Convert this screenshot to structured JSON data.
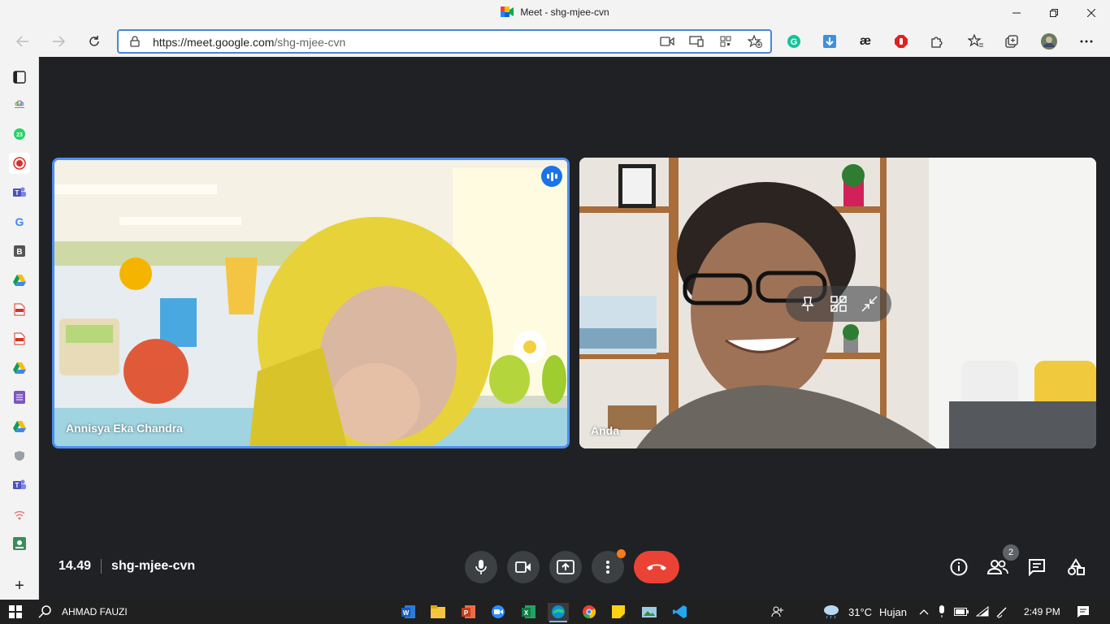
{
  "window": {
    "title": "Meet - shg-mjee-cvn",
    "minimize_icon": "minimize-icon",
    "restore_icon": "restore-icon",
    "close_icon": "close-icon"
  },
  "browser": {
    "url_host": "https://meet.google.com",
    "url_path": "/shg-mjee-cvn",
    "address_icons": [
      "camera-icon",
      "cast-icon",
      "qr-code-icon",
      "add-favorite-icon"
    ],
    "extensions": [
      "grammarly-icon",
      "download-icon",
      "ae-extension-icon",
      "adblock-icon",
      "extensions-puzzle-icon",
      "favorites-icon",
      "collections-icon",
      "profile-avatar",
      "more-icon"
    ]
  },
  "sidebar": {
    "items": [
      "tab-actions-icon",
      "photo-app-icon",
      "whatsapp-icon",
      "record-icon",
      "teams-icon",
      "google-icon",
      "bookmark-b-icon",
      "google-drive-icon",
      "pdf-icon",
      "pdf-icon",
      "google-drive-icon",
      "forms-icon",
      "google-drive-icon",
      "shield-icon",
      "teams-icon",
      "wifi-signal-icon",
      "classroom-icon"
    ],
    "add_label": "+"
  },
  "meeting": {
    "participants": [
      {
        "name": "Annisya Eka Chandra",
        "speaking": true
      },
      {
        "name": "Anda",
        "speaking": false
      }
    ],
    "time": "14.49",
    "code": "shg-mjee-cvn",
    "participant_count": "2",
    "colors": {
      "accent": "#1a73e8",
      "end_call": "#ea4335",
      "notification": "#fa7b17",
      "background": "#202124"
    }
  },
  "taskbar": {
    "user": "AHMAD FAUZI",
    "weather_temp": "31°C",
    "weather_desc": "Hujan",
    "clock": "2:49 PM"
  }
}
